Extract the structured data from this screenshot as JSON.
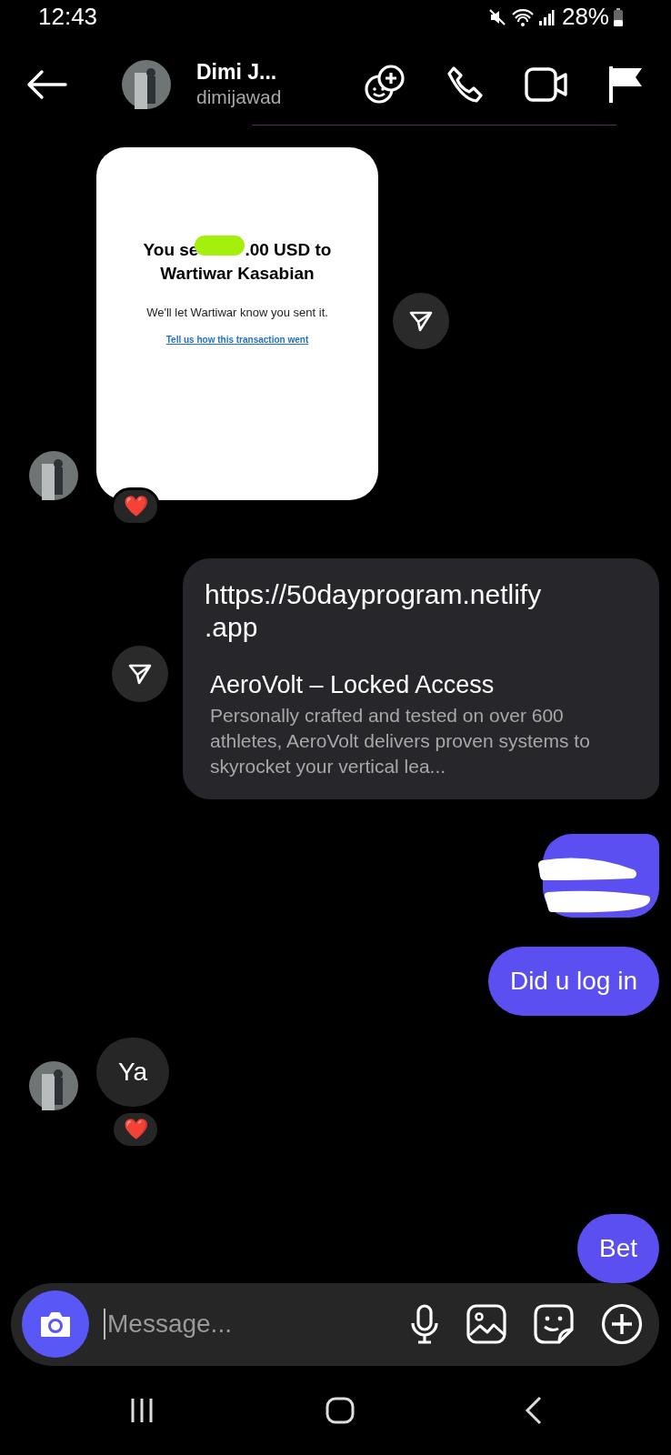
{
  "status_bar": {
    "time": "12:43",
    "battery": "28%"
  },
  "header": {
    "name": "Dimi J...",
    "username": "dimijawad"
  },
  "messages": [
    {
      "kind": "shared_image",
      "outgoing": false,
      "title_start": "You se",
      "title_end": ".00 USD to",
      "title_line2": "Wartiwar Kasabian",
      "body": "We'll let Wartiwar know you sent it.",
      "link": "Tell us how this transaction went",
      "reaction": "❤️"
    },
    {
      "kind": "link",
      "outgoing": true,
      "url": "https://50dayprogram.netlify\n.app",
      "title": "AeroVolt – Locked Access",
      "description": "Personally crafted and tested on over 600 athletes, AeroVolt delivers proven systems to skyrocket your vertical lea..."
    },
    {
      "kind": "redacted",
      "outgoing": true
    },
    {
      "kind": "text",
      "outgoing": true,
      "text": "Did u log in"
    },
    {
      "kind": "text",
      "outgoing": false,
      "text": "Ya",
      "reaction": "❤️"
    },
    {
      "kind": "text",
      "outgoing": true,
      "text": "Bet"
    }
  ],
  "composer": {
    "placeholder": "Message..."
  }
}
